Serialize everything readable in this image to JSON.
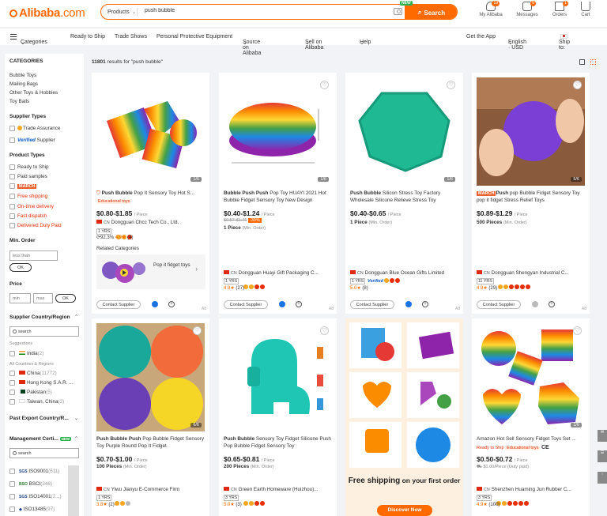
{
  "header": {
    "logo_text": "Alibaba",
    "logo_suffix": ".com",
    "search_category": "Products",
    "search_value": "push bubble",
    "search_button": "Search",
    "new_badge": "NEW",
    "icons": [
      {
        "label": "My Alibaba",
        "badge": "19"
      },
      {
        "label": "Messages",
        "badge": "6"
      },
      {
        "label": "Orders",
        "badge": "1"
      },
      {
        "label": "Cart",
        "badge": ""
      }
    ]
  },
  "nav": {
    "categories": "Categories",
    "items": [
      "Ready to Ship",
      "Trade Shows",
      "Personal Protective Equipment",
      "Source on Alibaba",
      "Sell on Alibaba",
      "Help"
    ],
    "get_app": "Get the App",
    "language": "English · USD",
    "ship_to": "Ship to:"
  },
  "sidebar": {
    "categories_h": "CATEGORIES",
    "categories": [
      "Bubble Toys",
      "Mailing Bags",
      "Other Toys & Hobbies",
      "Toy Balls"
    ],
    "supplier_types_h": "Supplier Types",
    "trade_assurance": "Trade Assurance",
    "verified": "Verified",
    "verified_supplier": "Supplier",
    "product_types_h": "Product Types",
    "ready_to_ship": "Ready to Ship",
    "paid_samples": "Paid samples",
    "march": "MARCH",
    "free_shipping": "Free shipping",
    "on_time_delivery": "On-time delivery",
    "fast_dispatch": "Fast dispatch",
    "delivered_duty_paid": "Delivered Duty Paid",
    "min_order_h": "Min. Order",
    "less_than": "less than",
    "ok": "OK",
    "price_h": "Price",
    "min": "min",
    "max": "max",
    "supplier_country_h": "Supplier Country/Region",
    "search_ph": "search",
    "suggestions": "Suggestions",
    "india": "India",
    "india_c": "(2)",
    "all_countries": "All Countries & Regions",
    "countries": [
      {
        "name": "China",
        "count": "(11772)"
      },
      {
        "name": "Hong Kong S.A.R. ...",
        "count": ""
      },
      {
        "name": "Pakistan",
        "count": "(5)"
      },
      {
        "name": "Taiwan, China",
        "count": "(2)"
      }
    ],
    "past_export_h": "Past Export Country/R...",
    "mgmt_h": "Management Certi...",
    "mgmt_new": "NEW",
    "certs": [
      {
        "name": "ISO9001",
        "count": "(611)"
      },
      {
        "name": "BSCI",
        "count": "(346)"
      },
      {
        "name": "ISO14001",
        "count": "(2...)"
      },
      {
        "name": "ISO13485",
        "count": "(97)"
      }
    ]
  },
  "results": {
    "count": "11801",
    "text": "results for \"push bubble\""
  },
  "cards": [
    {
      "title_b": "Push Bubble",
      "title": " Pop It Sensory Toy Hot S...",
      "tag": "Educational toys",
      "price": "$0.80-$1.85",
      "unit": "/ Piece",
      "moq": "",
      "moq_unit": "",
      "supplier": "Dongguan Chcc Tech Co., Ltd.",
      "yrs": "1 YRS",
      "rate": "92.3%",
      "score": "4.9",
      "reviews": "(4)",
      "page": "1/6",
      "flag_tag": ""
    },
    {
      "title_b": "Bubble Push Push",
      "title": " Pop Toy HUAYI 2021 Hot Bubble Fidget Sensory Toy New Design",
      "price": "$0.40-$1.24",
      "unit": "/ Piece",
      "old": "$0.57-$1.76",
      "off": "-30%",
      "moq": "1 Piece",
      "moq_unit": "(Min. Order)",
      "supplier": "Dongguan Huayi Gift Packaging C...",
      "yrs": "1 YRS",
      "score": "4.9",
      "reviews": "(27)",
      "page": "1/6"
    },
    {
      "title_b": "Push Bubble",
      "title": " Silicon Stress Toy Factory Wholesale Silicone Relieve Stress Toy",
      "price": "$0.40-$0.65",
      "unit": "/ Piece",
      "moq": "1 Piece",
      "moq_unit": "(Min. Order)",
      "supplier": "Dongguan Blue Ocean Gifts Limited",
      "yrs": "1 YRS",
      "score": "5.0",
      "reviews": "(8)",
      "page": "1/6"
    },
    {
      "title_b": "Push",
      "title": " pop Bubble Fidget Sensory Toy pop it fidget Stress Relief Toys",
      "march": "MARCH",
      "price": "$0.89-$1.29",
      "unit": "/ Piece",
      "moq": "500 Pieces",
      "moq_unit": "(Min. Order)",
      "supplier": "Dongguan Shengyan Industrial C...",
      "yrs": "11 YRS",
      "score": "4.9",
      "reviews": "(29)",
      "page": "5/6"
    },
    {
      "title_b": "Push Bubble Push",
      "title": " Pop Bubble Fidget Sensory Toy Purple Round Pop It Fidget",
      "price": "$0.70-$1.00",
      "unit": "/ Piece",
      "moq": "100 Pieces",
      "moq_unit": "(Min. Order)",
      "supplier": "Yiwu Jianyu E-Commerce Firm",
      "yrs": "1 YRS",
      "score": "3.8",
      "reviews": "(2)",
      "page": "6/6"
    },
    {
      "title_b": "Push Bubble",
      "title": " Sensory Toy Fidget Silicone Push Pop Bubble Fidget Sensory Toy",
      "price": "$0.65-$0.81",
      "unit": "/ Piece",
      "moq": "200 Pieces",
      "moq_unit": "(Min. Order)",
      "supplier": "Green Earth Homeware (Huizhou)...",
      "yrs": "3 YRS",
      "score": "5.0",
      "reviews": "(3)",
      "page": ""
    },
    {
      "banner_text_a": "Free shipping",
      "banner_text_b": " on your first order",
      "banner_btn": "Discover Now"
    },
    {
      "title": "Amazon Hot Sell Sensory Fidget Toys Set ...",
      "tag_rts": "Ready to Ship",
      "tag_edu": "Educational toys",
      "ce": "CE",
      "price": "$0.50-$0.72",
      "unit": "/ Piece",
      "shipping": "$1.00/Piece (Duty paid)",
      "moq": "",
      "supplier": "Shenzhen Huaming Jun Rubber C...",
      "yrs": "3 YRS",
      "score": "4.9",
      "reviews": "(100)",
      "page": "1/6"
    }
  ],
  "related": {
    "h": "Related Categories",
    "label": "Pop it fidget toys"
  },
  "common": {
    "contact": "Contact Supplier",
    "cn": "CN",
    "ad": "Ad"
  },
  "colors": {
    "accent": "#ff6a00",
    "red": "#e62e04"
  }
}
